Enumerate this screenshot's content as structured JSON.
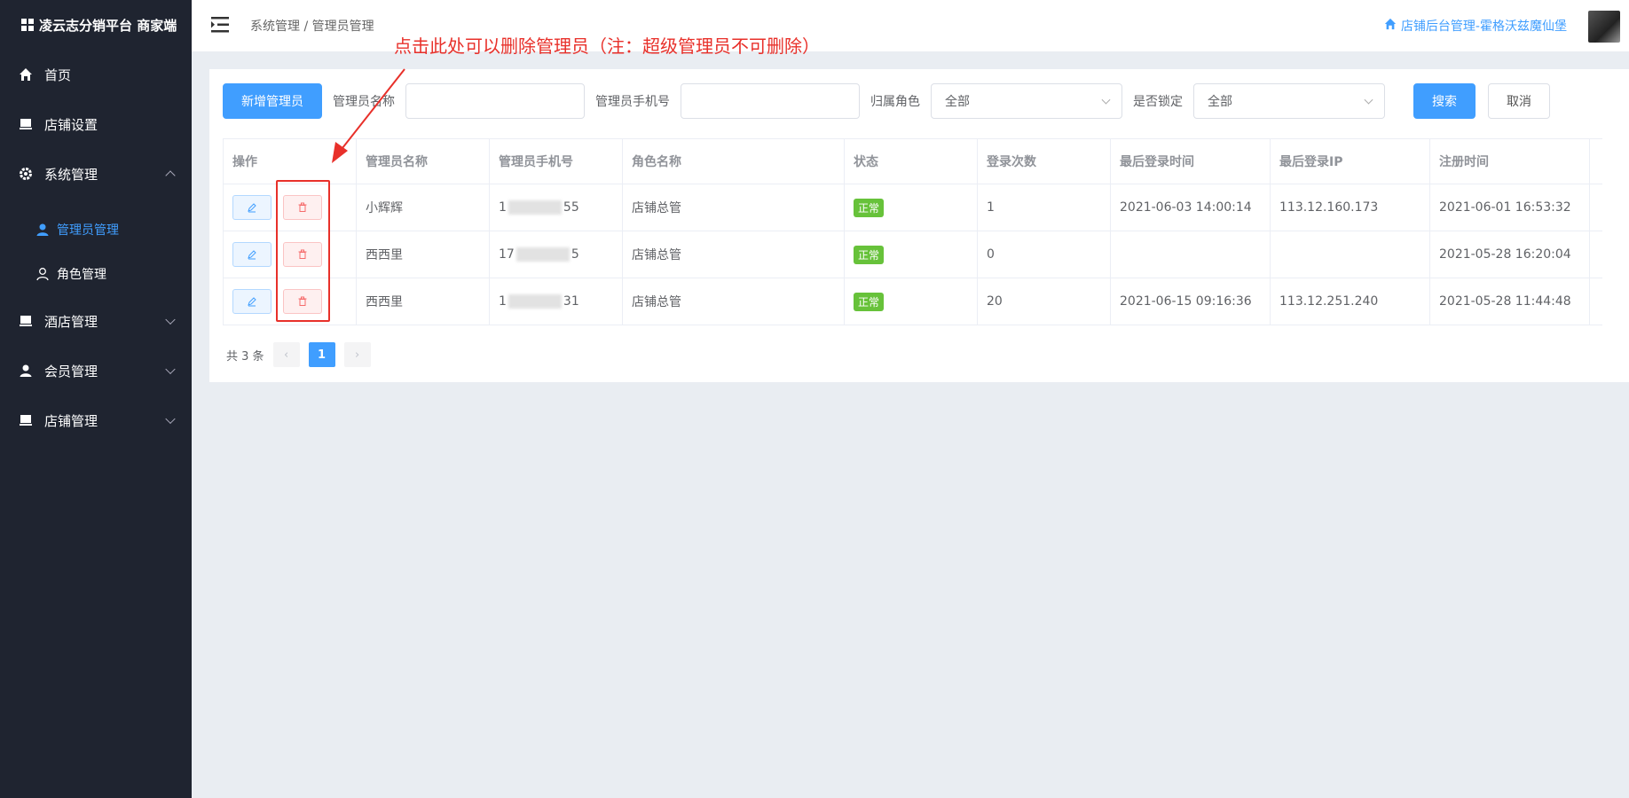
{
  "sidebar": {
    "brand": "凌云志分销平台 商家端",
    "items": [
      {
        "label": "首页"
      },
      {
        "label": "店铺设置"
      },
      {
        "label": "系统管理"
      },
      {
        "label": "酒店管理"
      },
      {
        "label": "会员管理"
      },
      {
        "label": "店铺管理"
      }
    ],
    "sub_items": [
      {
        "label": "管理员管理"
      },
      {
        "label": "角色管理"
      }
    ]
  },
  "header": {
    "breadcrumb": "系统管理 / 管理员管理",
    "store_link": "店铺后台管理-霍格沃兹魔仙堡"
  },
  "annotation": "点击此处可以删除管理员（注：超级管理员不可删除）",
  "toolbar": {
    "add_button": "新增管理员",
    "name_label": "管理员名称",
    "phone_label": "管理员手机号",
    "role_label": "归属角色",
    "role_value": "全部",
    "locked_label": "是否锁定",
    "locked_value": "全部",
    "search_button": "搜索",
    "cancel_button": "取消"
  },
  "table": {
    "headers": [
      "操作",
      "管理员名称",
      "管理员手机号",
      "角色名称",
      "状态",
      "登录次数",
      "最后登录时间",
      "最后登录IP",
      "注册时间"
    ],
    "rows": [
      {
        "name": "小辉辉",
        "phone_start": "1",
        "phone_end": "55",
        "role": "店铺总管",
        "status": "正常",
        "logins": "1",
        "last_login": "2021-06-03 14:00:14",
        "last_ip": "113.12.160.173",
        "registered": "2021-06-01 16:53:32"
      },
      {
        "name": "西西里",
        "phone_start": "17",
        "phone_end": "5",
        "role": "店铺总管",
        "status": "正常",
        "logins": "0",
        "last_login": "",
        "last_ip": "",
        "registered": "2021-05-28 16:20:04"
      },
      {
        "name": "西西里",
        "phone_start": "1",
        "phone_end": "31",
        "role": "店铺总管",
        "status": "正常",
        "logins": "20",
        "last_login": "2021-06-15 09:16:36",
        "last_ip": "113.12.251.240",
        "registered": "2021-05-28 11:44:48"
      }
    ]
  },
  "pagination": {
    "total": "共 3 条",
    "current": "1",
    "prev": "‹",
    "next": "›"
  },
  "colors": {
    "sidebar_bg": "#1f2430",
    "primary": "#409eff",
    "danger": "#e8302a",
    "success": "#67c23a"
  }
}
